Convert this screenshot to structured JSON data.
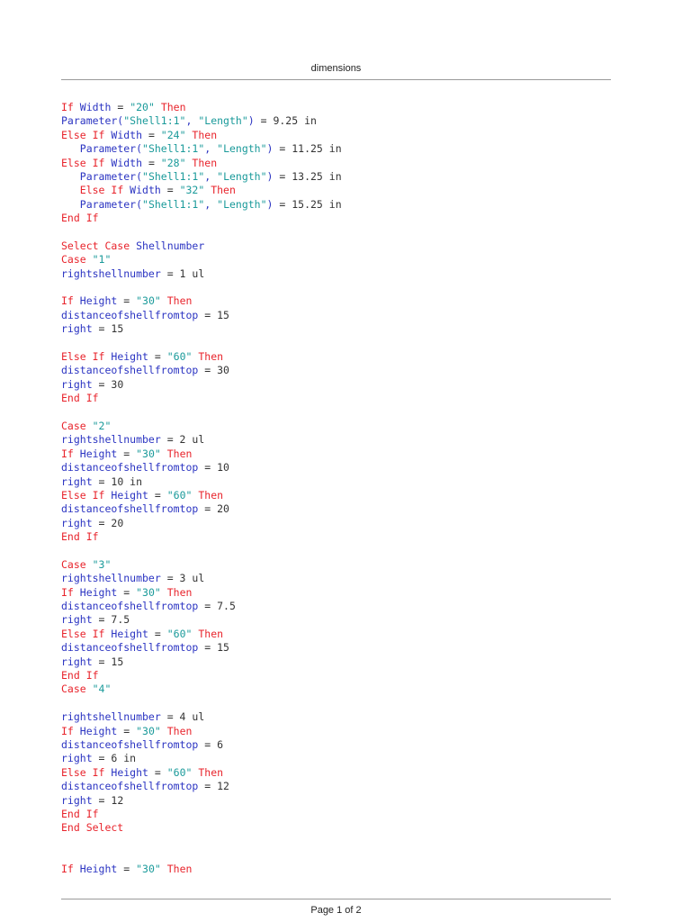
{
  "header": {
    "title": "dimensions"
  },
  "footer": {
    "page_label": "Page 1 of 2"
  },
  "code": {
    "lines": [
      [
        [
          "kw",
          "If "
        ],
        [
          "id",
          "Width"
        ],
        [
          "plain",
          " = "
        ],
        [
          "str",
          "\"20\""
        ],
        [
          "kw",
          " Then"
        ]
      ],
      [
        [
          "id",
          "Parameter("
        ],
        [
          "str",
          "\"Shell1:1\""
        ],
        [
          "id",
          ", "
        ],
        [
          "str",
          "\"Length\""
        ],
        [
          "id",
          ")"
        ],
        [
          "plain",
          " = 9.25 in"
        ]
      ],
      [
        [
          "kw",
          "Else If "
        ],
        [
          "id",
          "Width"
        ],
        [
          "plain",
          " = "
        ],
        [
          "str",
          "\"24\""
        ],
        [
          "kw",
          " Then"
        ]
      ],
      [
        [
          "plain",
          "   "
        ],
        [
          "id",
          "Parameter("
        ],
        [
          "str",
          "\"Shell1:1\""
        ],
        [
          "id",
          ", "
        ],
        [
          "str",
          "\"Length\""
        ],
        [
          "id",
          ")"
        ],
        [
          "plain",
          " = 11.25 in"
        ]
      ],
      [
        [
          "kw",
          "Else If "
        ],
        [
          "id",
          "Width"
        ],
        [
          "plain",
          " = "
        ],
        [
          "str",
          "\"28\""
        ],
        [
          "kw",
          " Then"
        ]
      ],
      [
        [
          "plain",
          "   "
        ],
        [
          "id",
          "Parameter("
        ],
        [
          "str",
          "\"Shell1:1\""
        ],
        [
          "id",
          ", "
        ],
        [
          "str",
          "\"Length\""
        ],
        [
          "id",
          ")"
        ],
        [
          "plain",
          " = 13.25 in"
        ]
      ],
      [
        [
          "plain",
          "   "
        ],
        [
          "kw",
          "Else If "
        ],
        [
          "id",
          "Width"
        ],
        [
          "plain",
          " = "
        ],
        [
          "str",
          "\"32\""
        ],
        [
          "kw",
          " Then"
        ]
      ],
      [
        [
          "plain",
          "   "
        ],
        [
          "id",
          "Parameter("
        ],
        [
          "str",
          "\"Shell1:1\""
        ],
        [
          "id",
          ", "
        ],
        [
          "str",
          "\"Length\""
        ],
        [
          "id",
          ")"
        ],
        [
          "plain",
          " = 15.25 in"
        ]
      ],
      [
        [
          "kw",
          "End If"
        ]
      ],
      [],
      [
        [
          "kw",
          "Select Case "
        ],
        [
          "id",
          "Shellnumber"
        ]
      ],
      [
        [
          "kw",
          "Case "
        ],
        [
          "str",
          "\"1\""
        ]
      ],
      [
        [
          "id",
          "rightshellnumber"
        ],
        [
          "plain",
          " = 1 ul"
        ]
      ],
      [],
      [
        [
          "kw",
          "If "
        ],
        [
          "id",
          "Height"
        ],
        [
          "plain",
          " = "
        ],
        [
          "str",
          "\"30\""
        ],
        [
          "kw",
          " Then"
        ]
      ],
      [
        [
          "id",
          "distanceofshellfromtop"
        ],
        [
          "plain",
          " = 15"
        ]
      ],
      [
        [
          "id",
          "right"
        ],
        [
          "plain",
          " = 15"
        ]
      ],
      [],
      [
        [
          "kw",
          "Else If "
        ],
        [
          "id",
          "Height"
        ],
        [
          "plain",
          " = "
        ],
        [
          "str",
          "\"60\""
        ],
        [
          "kw",
          " Then"
        ]
      ],
      [
        [
          "id",
          "distanceofshellfromtop"
        ],
        [
          "plain",
          " = 30"
        ]
      ],
      [
        [
          "id",
          "right"
        ],
        [
          "plain",
          " = 30"
        ]
      ],
      [
        [
          "kw",
          "End If"
        ]
      ],
      [],
      [
        [
          "kw",
          "Case "
        ],
        [
          "str",
          "\"2\""
        ]
      ],
      [
        [
          "id",
          "rightshellnumber"
        ],
        [
          "plain",
          " = 2 ul"
        ]
      ],
      [
        [
          "kw",
          "If "
        ],
        [
          "id",
          "Height"
        ],
        [
          "plain",
          " = "
        ],
        [
          "str",
          "\"30\""
        ],
        [
          "kw",
          " Then"
        ]
      ],
      [
        [
          "id",
          "distanceofshellfromtop"
        ],
        [
          "plain",
          " = 10"
        ]
      ],
      [
        [
          "id",
          "right"
        ],
        [
          "plain",
          " = 10 in"
        ]
      ],
      [
        [
          "kw",
          "Else If "
        ],
        [
          "id",
          "Height"
        ],
        [
          "plain",
          " = "
        ],
        [
          "str",
          "\"60\""
        ],
        [
          "kw",
          " Then"
        ]
      ],
      [
        [
          "id",
          "distanceofshellfromtop"
        ],
        [
          "plain",
          " = 20"
        ]
      ],
      [
        [
          "id",
          "right"
        ],
        [
          "plain",
          " = 20"
        ]
      ],
      [
        [
          "kw",
          "End If"
        ]
      ],
      [],
      [
        [
          "kw",
          "Case "
        ],
        [
          "str",
          "\"3\""
        ]
      ],
      [
        [
          "id",
          "rightshellnumber"
        ],
        [
          "plain",
          " = 3 ul"
        ]
      ],
      [
        [
          "kw",
          "If "
        ],
        [
          "id",
          "Height"
        ],
        [
          "plain",
          " = "
        ],
        [
          "str",
          "\"30\""
        ],
        [
          "kw",
          " Then"
        ]
      ],
      [
        [
          "id",
          "distanceofshellfromtop"
        ],
        [
          "plain",
          " = 7.5"
        ]
      ],
      [
        [
          "id",
          "right"
        ],
        [
          "plain",
          " = 7.5"
        ]
      ],
      [
        [
          "kw",
          "Else If "
        ],
        [
          "id",
          "Height"
        ],
        [
          "plain",
          " = "
        ],
        [
          "str",
          "\"60\""
        ],
        [
          "kw",
          " Then"
        ]
      ],
      [
        [
          "id",
          "distanceofshellfromtop"
        ],
        [
          "plain",
          " = 15"
        ]
      ],
      [
        [
          "id",
          "right"
        ],
        [
          "plain",
          " = 15"
        ]
      ],
      [
        [
          "kw",
          "End If"
        ]
      ],
      [
        [
          "kw",
          "Case "
        ],
        [
          "str",
          "\"4\""
        ]
      ],
      [],
      [
        [
          "id",
          "rightshellnumber"
        ],
        [
          "plain",
          " = 4 ul"
        ]
      ],
      [
        [
          "kw",
          "If "
        ],
        [
          "id",
          "Height"
        ],
        [
          "plain",
          " = "
        ],
        [
          "str",
          "\"30\""
        ],
        [
          "kw",
          " Then"
        ]
      ],
      [
        [
          "id",
          "distanceofshellfromtop"
        ],
        [
          "plain",
          " = 6"
        ]
      ],
      [
        [
          "id",
          "right"
        ],
        [
          "plain",
          " = 6 in"
        ]
      ],
      [
        [
          "kw",
          "Else If "
        ],
        [
          "id",
          "Height"
        ],
        [
          "plain",
          " = "
        ],
        [
          "str",
          "\"60\""
        ],
        [
          "kw",
          " Then"
        ]
      ],
      [
        [
          "id",
          "distanceofshellfromtop"
        ],
        [
          "plain",
          " = 12"
        ]
      ],
      [
        [
          "id",
          "right"
        ],
        [
          "plain",
          " = 12"
        ]
      ],
      [
        [
          "kw",
          "End If"
        ]
      ],
      [
        [
          "kw",
          "End Select"
        ]
      ],
      [],
      [],
      [
        [
          "kw",
          "If "
        ],
        [
          "id",
          "Height"
        ],
        [
          "plain",
          " = "
        ],
        [
          "str",
          "\"30\""
        ],
        [
          "kw",
          " Then"
        ]
      ]
    ]
  }
}
